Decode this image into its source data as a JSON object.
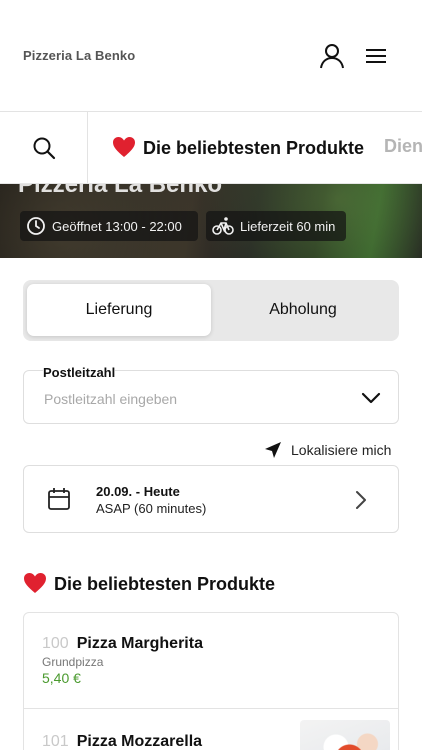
{
  "header": {
    "brand": "Pizzeria La Benko",
    "icons": {
      "user": "user-icon",
      "menu": "hamburger-menu-icon"
    }
  },
  "categories": {
    "search_icon": "search-icon",
    "active": "Die beliebtesten Produkte",
    "next_partial": "Dien"
  },
  "hero": {
    "title": "Pizzeria La Benko",
    "opening": "Geöffnet 13:00 - 22:00",
    "delivery_time": "Lieferzeit 60 min"
  },
  "order_mode": {
    "options": [
      "Lieferung",
      "Abholung"
    ],
    "selected": "Lieferung"
  },
  "zip": {
    "label": "Postleitzahl",
    "placeholder": "Postleitzahl eingeben",
    "value": ""
  },
  "locate": {
    "label": "Lokalisiere mich"
  },
  "schedule": {
    "date": "20.09. - Heute",
    "time": "ASAP (60 minutes)"
  },
  "section": {
    "title": "Die beliebtesten Produkte"
  },
  "products": [
    {
      "number": "100",
      "name": "Pizza Margherita",
      "description": "Grundpizza",
      "price": "5,40 €"
    },
    {
      "number": "101",
      "name": "Pizza Mozzarella"
    }
  ],
  "colors": {
    "price_green": "#4a9a2e",
    "heart_red": "#e0212f",
    "segment_bg": "#e8e8e8"
  }
}
